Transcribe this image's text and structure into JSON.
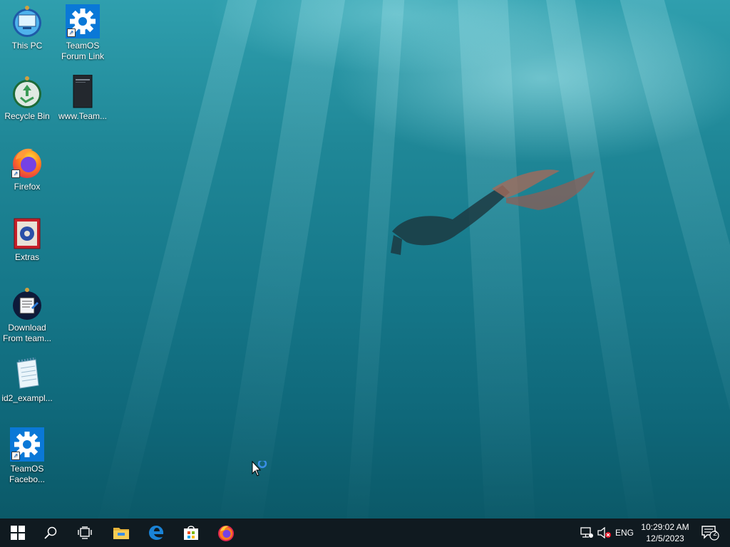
{
  "desktop": {
    "icons": [
      {
        "label": "This PC"
      },
      {
        "label": "TeamOS Forum Link"
      },
      {
        "label": "Recycle Bin"
      },
      {
        "label": "www.Team..."
      },
      {
        "label": "Firefox"
      },
      {
        "label": "Extras"
      },
      {
        "label": "Download From team..."
      },
      {
        "label": "id2_exampl..."
      },
      {
        "label": "TeamOS Facebo..."
      }
    ]
  },
  "taskbar": {
    "start_icon": "windows-logo-icon",
    "search_icon": "search-icon",
    "taskview_icon": "task-view-icon",
    "pinned": [
      "file-explorer-icon",
      "edge-icon",
      "store-icon",
      "firefox-icon"
    ]
  },
  "tray": {
    "language": "ENG",
    "time": "10:29:02 AM",
    "date": "12/5/2023",
    "notification_count": "2"
  },
  "colors": {
    "taskbar_bg": "#101a20",
    "accent": "#0a78d7"
  }
}
